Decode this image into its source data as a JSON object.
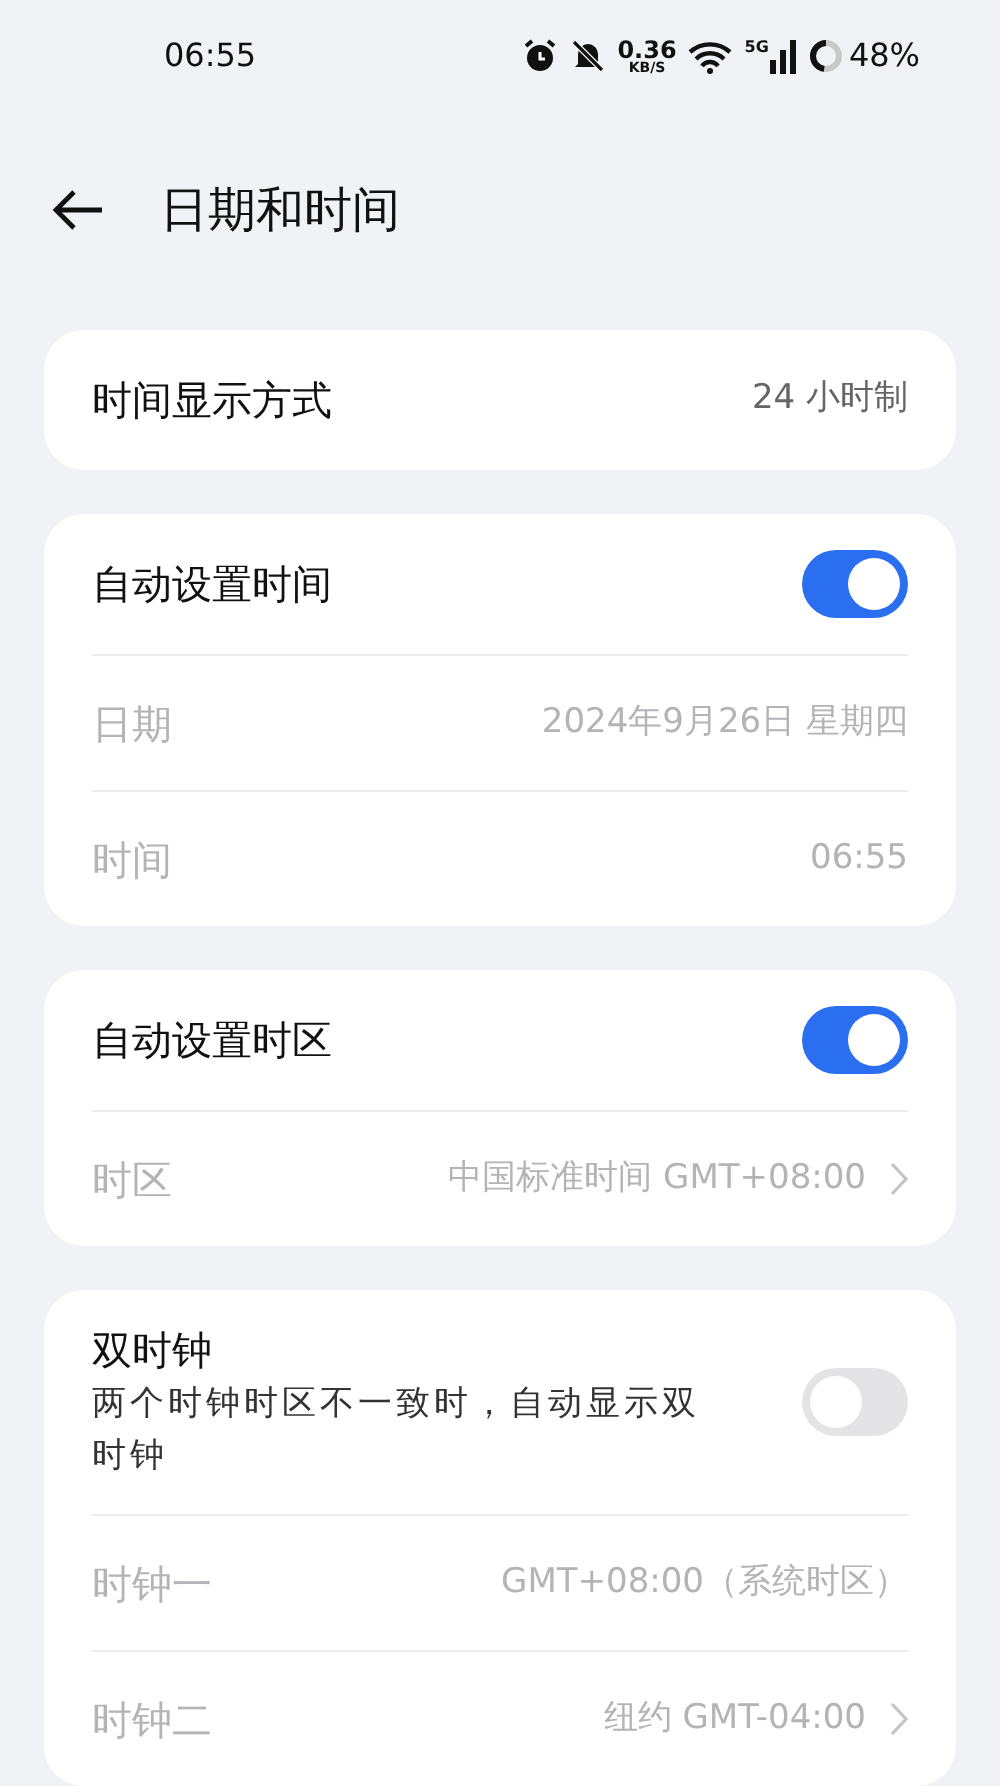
{
  "status_bar": {
    "time": "06:55",
    "speed": "0.36",
    "speed_unit": "KB/S",
    "network": "5G",
    "battery": "48%"
  },
  "header": {
    "title": "日期和时间"
  },
  "cards": [
    {
      "rows": [
        {
          "kind": "value",
          "label": "时间显示方式",
          "value": "24 小时制",
          "disabled": false,
          "chevron": false
        }
      ]
    },
    {
      "rows": [
        {
          "kind": "toggle",
          "label": "自动设置时间",
          "on": true
        },
        {
          "kind": "value",
          "label": "日期",
          "value": "2024年9月26日 星期四",
          "disabled": true,
          "chevron": false
        },
        {
          "kind": "value",
          "label": "时间",
          "value": "06:55",
          "disabled": true,
          "chevron": false
        }
      ]
    },
    {
      "rows": [
        {
          "kind": "toggle",
          "label": "自动设置时区",
          "on": true
        },
        {
          "kind": "value",
          "label": "时区",
          "value": "中国标准时间 GMT+08:00",
          "disabled": true,
          "chevron": true
        }
      ]
    },
    {
      "rows": [
        {
          "kind": "toggle",
          "label": "双时钟",
          "subtitle": "两个时钟时区不一致时，自动显示双时钟",
          "on": false
        },
        {
          "kind": "value",
          "label": "时钟一",
          "value": "GMT+08:00（系统时区）",
          "disabled": true,
          "chevron": false
        },
        {
          "kind": "value",
          "label": "时钟二",
          "value": "纽约 GMT-04:00",
          "disabled": true,
          "chevron": true
        }
      ]
    }
  ]
}
